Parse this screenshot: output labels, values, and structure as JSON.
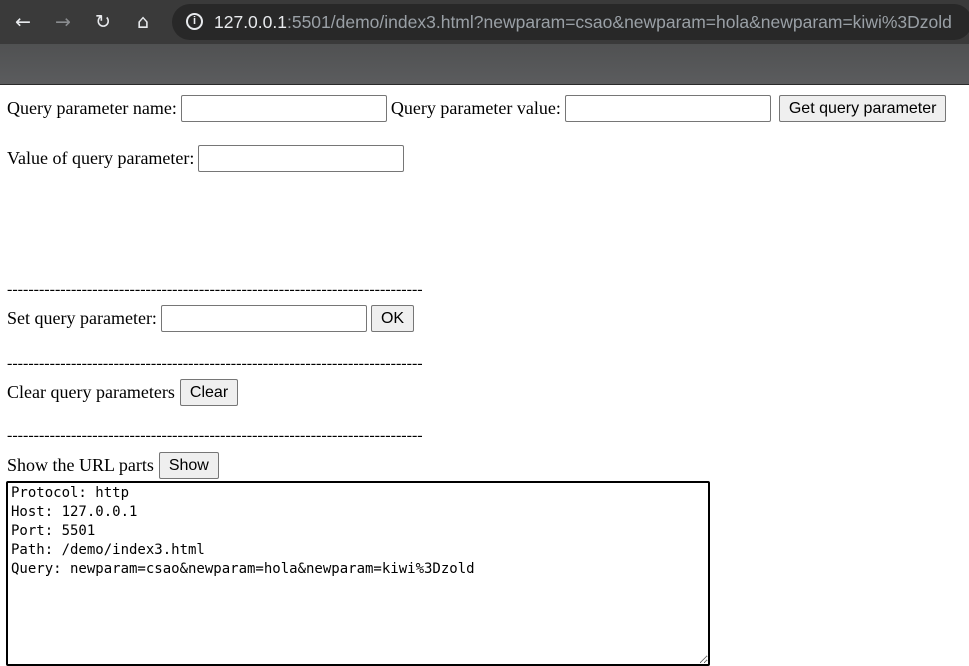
{
  "browser": {
    "url_host": "127.0.0.1",
    "url_rest": ":5501/demo/index3.html?newparam=csao&newparam=hola&newparam=kiwi%3Dzold"
  },
  "form": {
    "param_name_label": "Query parameter name:",
    "param_name_value": "",
    "param_value_label": "Query parameter value:",
    "param_value_value": "",
    "get_button": "Get query parameter",
    "value_of_label": "Value of query parameter:",
    "value_of_value": "",
    "divider": "------------------------------------------------------------------------------",
    "set_label": "Set query parameter:",
    "set_value": "",
    "ok_button": "OK",
    "clear_label": "Clear query parameters",
    "clear_button": "Clear",
    "show_label": "Show the URL parts",
    "show_button": "Show",
    "output": "Protocol: http\nHost: 127.0.0.1\nPort: 5501\nPath: /demo/index3.html\nQuery: newparam=csao&newparam=hola&newparam=kiwi%3Dzold"
  }
}
